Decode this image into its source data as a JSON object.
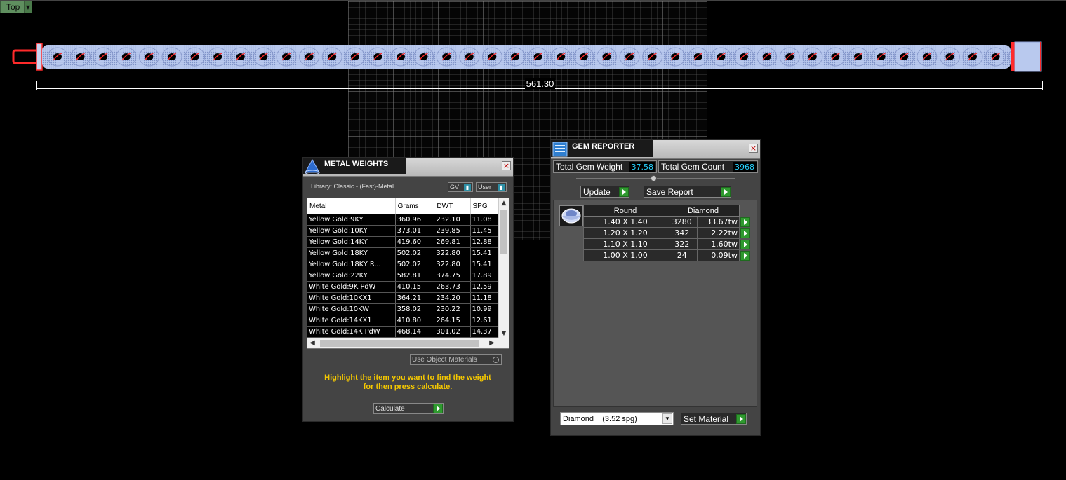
{
  "viewport": {
    "view_label": "Top",
    "dimension": "561.30"
  },
  "metal_weights": {
    "title": "METAL WEIGHTS",
    "library": "Library: Classic - (Fast)-Metal",
    "gv_label": "GV",
    "user_label": "User",
    "columns": [
      "Metal",
      "Grams",
      "DWT",
      "SPG"
    ],
    "rows": [
      {
        "metal": "Yellow Gold:9KY",
        "grams": "360.96",
        "dwt": "232.10",
        "spg": "11.08"
      },
      {
        "metal": "Yellow Gold:10KY",
        "grams": "373.01",
        "dwt": "239.85",
        "spg": "11.45"
      },
      {
        "metal": "Yellow Gold:14KY",
        "grams": "419.60",
        "dwt": "269.81",
        "spg": "12.88"
      },
      {
        "metal": "Yellow Gold:18KY",
        "grams": "502.02",
        "dwt": "322.80",
        "spg": "15.41"
      },
      {
        "metal": "Yellow Gold:18KY R...",
        "grams": "502.02",
        "dwt": "322.80",
        "spg": "15.41"
      },
      {
        "metal": "Yellow Gold:22KY",
        "grams": "582.81",
        "dwt": "374.75",
        "spg": "17.89"
      },
      {
        "metal": "White Gold:9K PdW",
        "grams": "410.15",
        "dwt": "263.73",
        "spg": "12.59"
      },
      {
        "metal": "White Gold:10KX1",
        "grams": "364.21",
        "dwt": "234.20",
        "spg": "11.18"
      },
      {
        "metal": "White Gold:10KW",
        "grams": "358.02",
        "dwt": "230.22",
        "spg": "10.99"
      },
      {
        "metal": "White Gold:14KX1",
        "grams": "410.80",
        "dwt": "264.15",
        "spg": "12.61"
      },
      {
        "metal": "White Gold:14K PdW",
        "grams": "468.14",
        "dwt": "301.02",
        "spg": "14.37"
      }
    ],
    "use_object_materials": "Use Object Materials",
    "instruction_line1": "Highlight the item you want to find the weight",
    "instruction_line2": "for then press calculate.",
    "calculate_label": "Calculate"
  },
  "gem_reporter": {
    "title": "GEM REPORTER",
    "total_weight_label": "Total Gem Weight",
    "total_weight_value": "37.58",
    "total_count_label": "Total Gem Count",
    "total_count_value": "3968",
    "update_label": "Update",
    "save_report_label": "Save Report",
    "columns": [
      "Round",
      "Diamond"
    ],
    "rows": [
      {
        "size": "1.40 X 1.40",
        "count": "3280",
        "tw": "33.67tw"
      },
      {
        "size": "1.20 X 1.20",
        "count": "342",
        "tw": "2.22tw"
      },
      {
        "size": "1.10 X 1.10",
        "count": "322",
        "tw": "1.60tw"
      },
      {
        "size": "1.00 X 1.00",
        "count": "24",
        "tw": "0.09tw"
      }
    ],
    "material_selected": "Diamond    (3.52 spg)",
    "set_material_label": "Set Material"
  }
}
